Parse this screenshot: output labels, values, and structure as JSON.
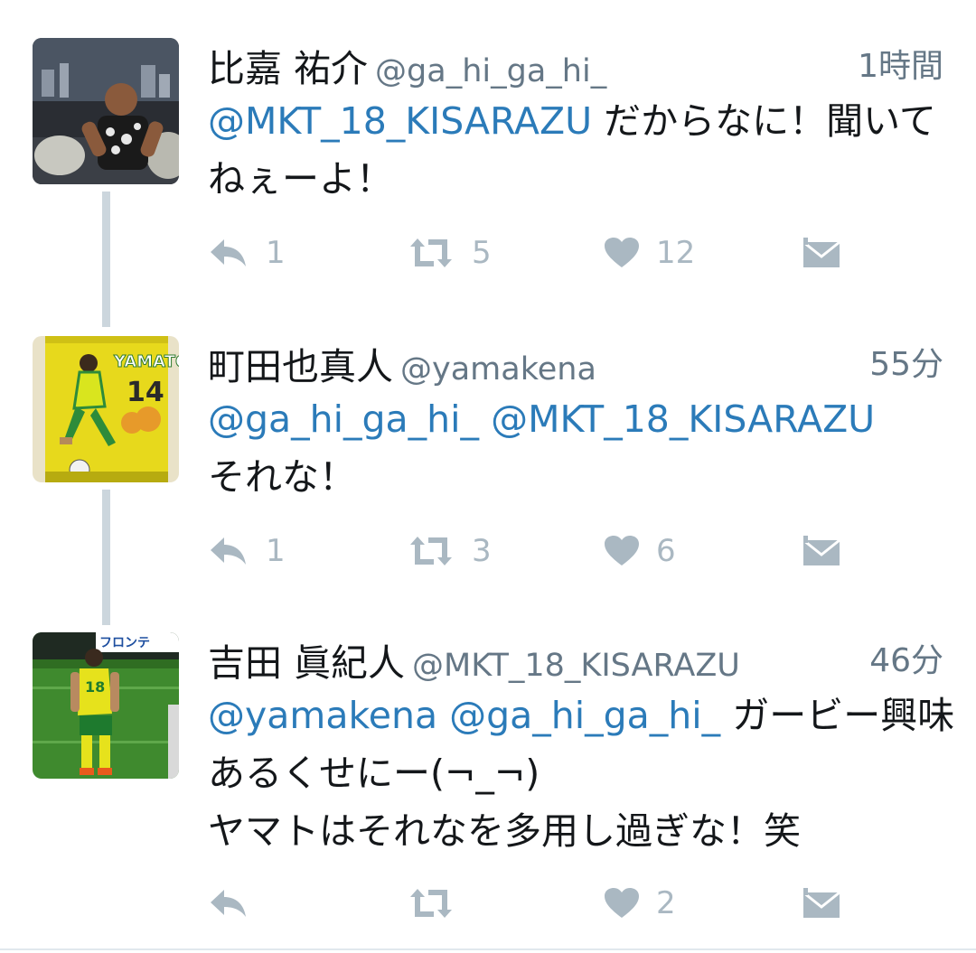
{
  "tweets": [
    {
      "name": "比嘉 祐介",
      "handle": "@ga_hi_ga_hi_",
      "time": "1時間",
      "body_mentions": "@MKT_18_KISARAZU",
      "body_text": " だからなに！聞いてねぇーよ！",
      "replies": "1",
      "retweets": "5",
      "likes": "12"
    },
    {
      "name": "町田也真人",
      "handle": "@yamakena",
      "time": "55分",
      "body_mentions": "@ga_hi_ga_hi_ @MKT_18_KISARAZU",
      "body_text": "それな！",
      "replies": "1",
      "retweets": "3",
      "likes": "6"
    },
    {
      "name": "吉田 眞紀人",
      "handle": "@MKT_18_KISARAZU",
      "time": "46分",
      "body_mentions": "@yamakena @ga_hi_ga_hi_",
      "body_text": " ガービー興味あるくせにー(¬_¬)",
      "body_line2": "ヤマトはそれなを多用し過ぎな！笑",
      "replies": "",
      "retweets": "",
      "likes": "2"
    }
  ],
  "icons": {
    "reply": "reply-icon",
    "retweet": "retweet-icon",
    "like": "heart-icon",
    "dm": "direct-message-icon"
  },
  "colors": {
    "mention": "#2b7bb9",
    "text": "#14171a",
    "meta": "#657786",
    "action": "#aab8c2",
    "thread_line": "#ccd6dd"
  }
}
